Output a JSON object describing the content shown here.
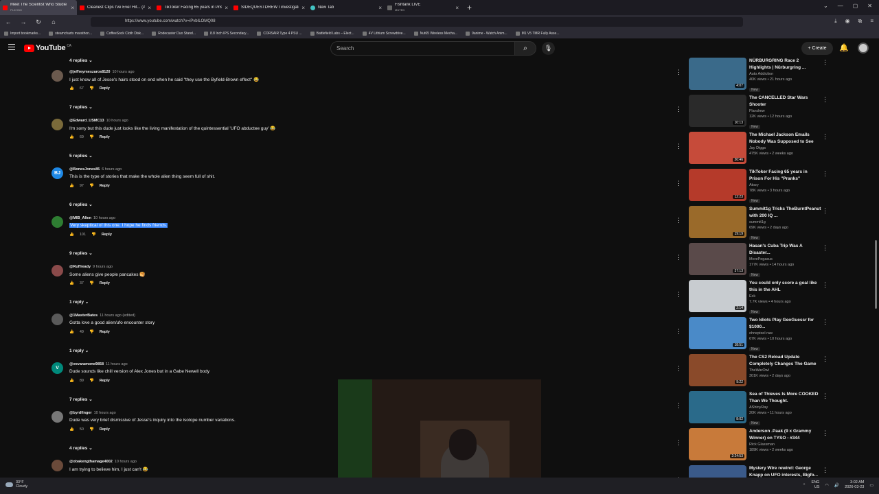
{
  "browser": {
    "tabs": [
      {
        "title": "Meet The Scientist Who Studie",
        "sub": "PLAYING",
        "active": true
      },
      {
        "title": "Cleanest Clips I've Ever Hit... (Ai",
        "sub": ""
      },
      {
        "title": "TikToker Facing 65 years in Pris",
        "sub": ""
      },
      {
        "title": "SIDEQUESTDREW I investigate",
        "sub": ""
      },
      {
        "title": "New Tab",
        "sub": ""
      },
      {
        "title": "Fishtank LIVE",
        "sub": "MUTED"
      }
    ],
    "url": "https://www.youtube.com/watch?v=iPvbILOMQ08",
    "bookmarks": [
      "Import bookmarks...",
      "steamcharts marathon...",
      "CoffeeSock Cloth Disk...",
      "Rodecaster Duo Stand...",
      "8.8 Inch IPS Secondary...",
      "CORSAIR Type 4 PSU ...",
      "Battlefield Labs – Elect...",
      "4V Lithium Screwdrive...",
      "Nut65 Wireless Mecha...",
      "9anime - Watch Anim...",
      "M1 V5 TMR Fully Asse..."
    ]
  },
  "youtube": {
    "logo_text": "YouTube",
    "logo_region": "CA",
    "search_placeholder": "Search",
    "create_label": "+ Create"
  },
  "comments": {
    "top_toggle": "4 replies",
    "items": [
      {
        "author": "@jeffreymeszaros8120",
        "time": "10 hours ago",
        "text": "I just know all of Jesse's hairs stood on end when he said \"they use the Byfield-Brown effect\" 😂",
        "likes": "67",
        "replies": "7 replies",
        "avatar": "",
        "color": "#6b5a4e"
      },
      {
        "author": "@Edward_USMC13",
        "time": "10 hours ago",
        "text": "I'm sorry but this dude just looks like the living manifestation of the quintessential 'UFO abductee guy' 😂",
        "likes": "69",
        "replies": "5 replies",
        "avatar": "",
        "color": "#7a6a3a"
      },
      {
        "author": "@BonesJones85",
        "time": "6 hours ago",
        "text": "This is the type of stories that make the whole alien thing seem full of shit.",
        "likes": "97",
        "replies": "6 replies",
        "avatar": "BJ",
        "color": "#1e88e5"
      },
      {
        "author": "@MIB_Alien",
        "time": "10 hours ago",
        "text": "Very skeptical of this one. I hope he finds friends.",
        "likes": "101",
        "replies": "9 replies",
        "avatar": "",
        "color": "#2e7d32",
        "selected": true
      },
      {
        "author": "@Ruffready",
        "time": "9 hours ago",
        "text": "Some aliens give people pancakes 🥞",
        "likes": "37",
        "replies": "1 reply",
        "avatar": "",
        "color": "#8a4a4a"
      },
      {
        "author": "@1MasterBates",
        "time": "11 hours ago (edited)",
        "text": "Gotta love a good alien/ufo encounter story",
        "likes": "49",
        "replies": "1 reply",
        "avatar": "",
        "color": "#5a5a5a"
      },
      {
        "author": "@vovaramone9858",
        "time": "11 hours ago",
        "text": "Dude sounds like chill version of Alex Jones but in a Gabe Newell body",
        "likes": "89",
        "replies": "7 replies",
        "avatar": "V",
        "color": "#00897b"
      },
      {
        "author": "@byrdfinger",
        "time": "10 hours ago",
        "text": "Dude was very brief dismissive of Jesse's inquiry into the isotope number variations.",
        "likes": "50",
        "replies": "4 replies",
        "avatar": "",
        "color": "#777777"
      },
      {
        "author": "@obakengthamage4002",
        "time": "10 hours ago",
        "text": "I am trying to believe him, I just can't 😂",
        "likes": "",
        "replies": "",
        "avatar": "",
        "color": "#6a4a3a"
      }
    ],
    "reply_label": "Reply"
  },
  "sidebar": {
    "videos": [
      {
        "title": "NÜRBURGRING Race 2 Highlights | Nürburgring ...",
        "channel": "Auto Addiction",
        "meta": "40K views • 21 hours ago",
        "badge": "New",
        "duration": "4:07",
        "thumb": "#3a6a8a"
      },
      {
        "title": "The CANCELLED Star Wars Shooter",
        "channel": "Flandrew",
        "meta": "12K views • 12 hours ago",
        "badge": "New",
        "duration": "10:13",
        "thumb": "#2a2a2a"
      },
      {
        "title": "The Michael Jackson Emails Nobody Was Supposed to See",
        "channel": "Jay Diggs",
        "meta": "475K views • 2 weeks ago",
        "badge": "",
        "duration": "20:46",
        "thumb": "#c64b3a"
      },
      {
        "title": "TikToker Facing 65 years in Prison For His \"Pranks\"",
        "channel": "Atozy",
        "meta": "78K views • 3 hours ago",
        "badge": "New",
        "duration": "12:23",
        "thumb": "#b53a2a"
      },
      {
        "title": "Summit1g Tricks TheBurntPeanut with 200 IQ ...",
        "channel": "summit1g",
        "meta": "69K views • 2 days ago",
        "badge": "New",
        "duration": "19:19",
        "thumb": "#9a6a2a"
      },
      {
        "title": "Hasan's Cuba Trip Was A Disaster...",
        "channel": "MorePegasus",
        "meta": "177K views • 14 hours ago",
        "badge": "New",
        "duration": "37:13",
        "thumb": "#5a4a4a"
      },
      {
        "title": "You could only score a goal like this in the AHL",
        "channel": "Eck",
        "meta": "7.7K views • 4 hours ago",
        "badge": "New",
        "duration": "2:14",
        "thumb": "#c8ccd0"
      },
      {
        "title": "Two Idiots Play GeoGuessr for $1000...",
        "channel": "ohnepixel raw",
        "meta": "67K views • 10 hours ago",
        "badge": "New",
        "duration": "18:51",
        "thumb": "#4a8ac8"
      },
      {
        "title": "The CS2 Reload Update Completely Changes The Game",
        "channel": "TheWarOwl",
        "meta": "301K views • 2 days ago",
        "badge": "",
        "duration": "9:22",
        "thumb": "#8a4a2a"
      },
      {
        "title": "Sea of Thieves Is More COOKED Than We Thought.",
        "channel": "AShinyRay",
        "meta": "20K views • 11 hours ago",
        "badge": "New",
        "duration": "8:02",
        "thumb": "#2a6a8a"
      },
      {
        "title": "Anderson .Paak (9 x Grammy Winner) on TYSO - #344",
        "channel": "Rick Glassman",
        "meta": "189K views • 2 weeks ago",
        "badge": "",
        "duration": "2:24:53",
        "thumb": "#c87a3a"
      },
      {
        "title": "Mystery Wire rewind: George Knapp on UFO interests, Bigfo...",
        "channel": "8 News Now – Las Vegas",
        "meta": "",
        "badge": "",
        "duration": "",
        "thumb": "#3a5a8a"
      }
    ]
  },
  "taskbar": {
    "temp": "33°F",
    "condition": "Cloudy",
    "lang": "ENG",
    "region": "US",
    "time": "3:02 AM",
    "date": "2026-03-23"
  }
}
